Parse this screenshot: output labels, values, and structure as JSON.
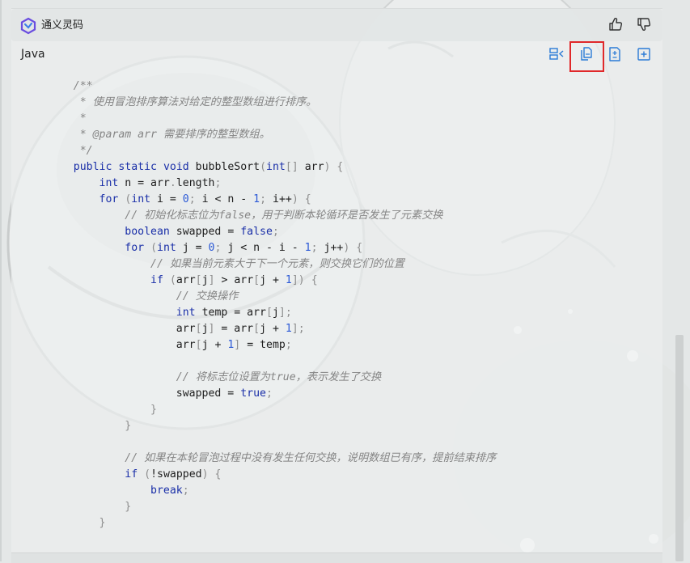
{
  "header": {
    "title": "通义灵码"
  },
  "code_block": {
    "language": "Java",
    "tools": [
      "insert-diff-icon",
      "copy-icon",
      "diff-icon",
      "insert-file-icon"
    ],
    "highlighted_tool": "copy-icon"
  },
  "colors": {
    "accent": "#2b7bd6",
    "highlight_box": "#e0282a",
    "keyword": "#1a2fa8",
    "number": "#2c5ad6",
    "comment": "#858585"
  },
  "code_lines": [
    "    /**",
    "     * 使用冒泡排序算法对给定的整型数组进行排序。",
    "     *",
    "     * @param arr 需要排序的整型数组。",
    "     */",
    "    public static void bubbleSort(int[] arr) {",
    "        int n = arr.length;",
    "        for (int i = 0; i < n - 1; i++) {",
    "            // 初始化标志位为false，用于判断本轮循环是否发生了元素交换",
    "            boolean swapped = false;",
    "            for (int j = 0; j < n - i - 1; j++) {",
    "                // 如果当前元素大于下一个元素，则交换它们的位置",
    "                if (arr[j] > arr[j + 1]) {",
    "                    // 交换操作",
    "                    int temp = arr[j];",
    "                    arr[j] = arr[j + 1];",
    "                    arr[j + 1] = temp;",
    "",
    "                    // 将标志位设置为true，表示发生了交换",
    "                    swapped = true;",
    "                }",
    "            }",
    "",
    "            // 如果在本轮冒泡过程中没有发生任何交换，说明数组已有序，提前结束排序",
    "            if (!swapped) {",
    "                break;",
    "            }",
    "        }"
  ]
}
